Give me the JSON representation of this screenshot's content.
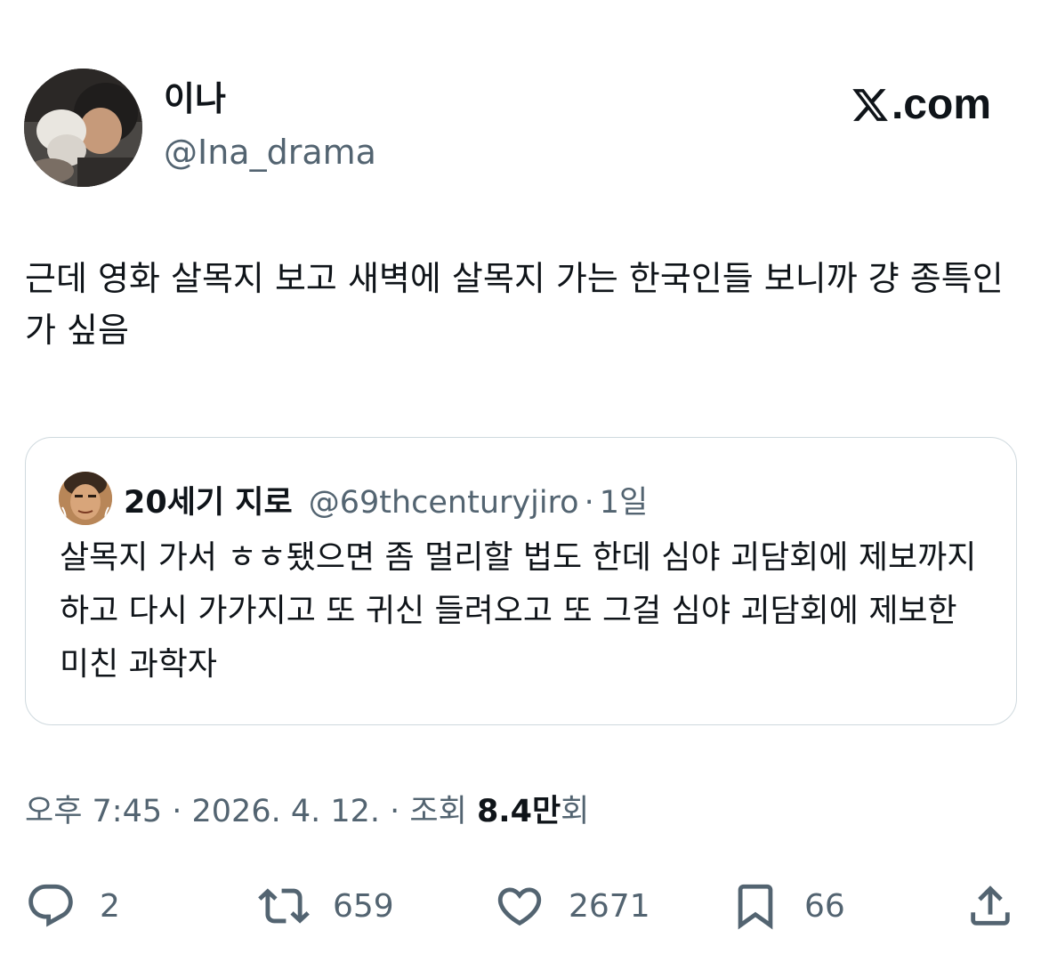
{
  "author": {
    "name": "이나",
    "handle": "@Ina_drama"
  },
  "brand": {
    "text": ".com"
  },
  "tweet": {
    "text": "근데 영화 살목지 보고 새벽에 살목지 가는 한국인들 보니까 걍 종특인가 싶음"
  },
  "quote": {
    "name": "20세기 지로",
    "handle": "@69thcenturyjiro",
    "separator": "·",
    "time": "1일",
    "text": "살목지 가서 ㅎㅎ됐으면 좀 멀리할 법도 한데 심야 괴담회에 제보까지 하고 다시 가가지고 또 귀신 들려오고 또 그걸 심야 괴담회에 제보한 미친 과학자"
  },
  "meta": {
    "time": "오후 7:45",
    "sep1": " · ",
    "date": "2026. 4. 12.",
    "sep2": " · ",
    "views_label": "조회 ",
    "views_value": "8.4만",
    "views_suffix": "회"
  },
  "actions": {
    "replies": "2",
    "retweets": "659",
    "likes": "2671",
    "bookmarks": "66"
  },
  "colors": {
    "text_primary": "#0f1419",
    "text_secondary": "#536471",
    "border": "#cfd9de"
  },
  "icons": {
    "reply": "reply-icon",
    "retweet": "retweet-icon",
    "like": "heart-icon",
    "bookmark": "bookmark-icon",
    "share": "share-icon"
  }
}
